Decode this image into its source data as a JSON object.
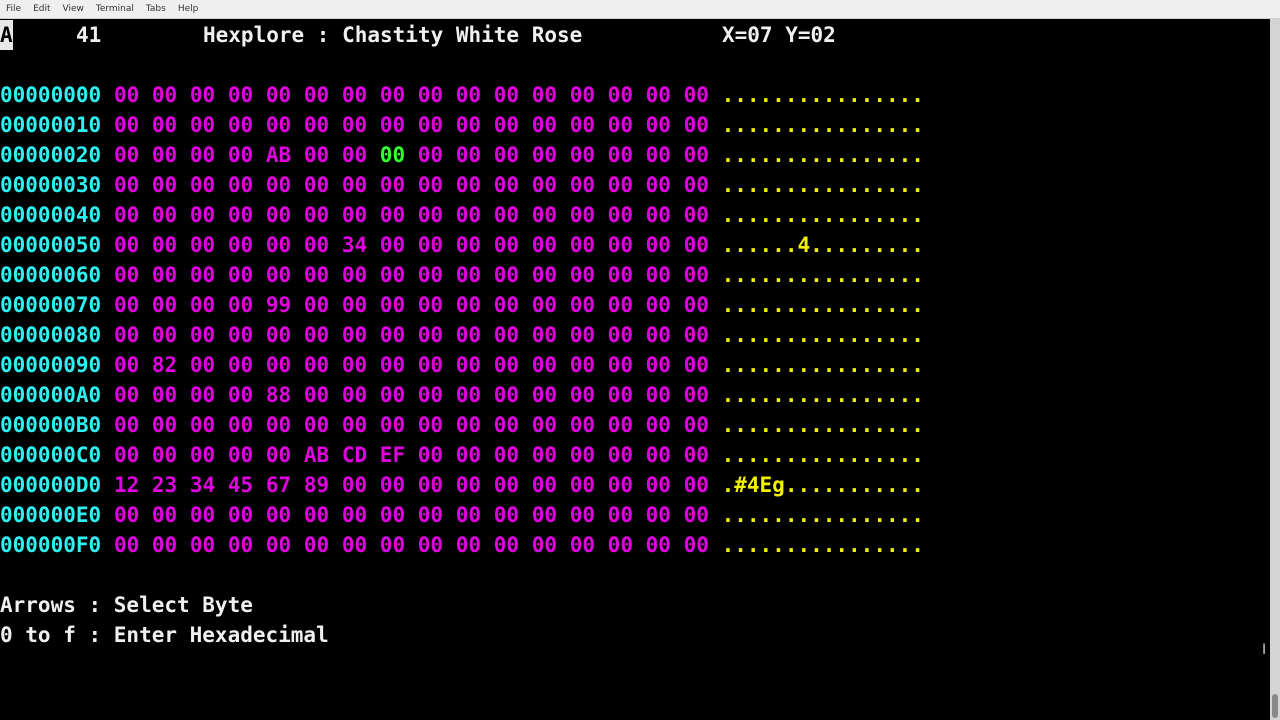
{
  "menu": [
    "File",
    "Edit",
    "View",
    "Terminal",
    "Tabs",
    "Help"
  ],
  "header": {
    "cursor_char": "A",
    "cursor_hex": "41",
    "title": "Hexplore : Chastity White Rose",
    "position": "X=07 Y=02"
  },
  "selected": {
    "x": 7,
    "y": 2
  },
  "rows": [
    {
      "addr": "00000000",
      "bytes": [
        "00",
        "00",
        "00",
        "00",
        "00",
        "00",
        "00",
        "00",
        "00",
        "00",
        "00",
        "00",
        "00",
        "00",
        "00",
        "00"
      ],
      "ascii": "................"
    },
    {
      "addr": "00000010",
      "bytes": [
        "00",
        "00",
        "00",
        "00",
        "00",
        "00",
        "00",
        "00",
        "00",
        "00",
        "00",
        "00",
        "00",
        "00",
        "00",
        "00"
      ],
      "ascii": "................"
    },
    {
      "addr": "00000020",
      "bytes": [
        "00",
        "00",
        "00",
        "00",
        "AB",
        "00",
        "00",
        "00",
        "00",
        "00",
        "00",
        "00",
        "00",
        "00",
        "00",
        "00"
      ],
      "ascii": "................"
    },
    {
      "addr": "00000030",
      "bytes": [
        "00",
        "00",
        "00",
        "00",
        "00",
        "00",
        "00",
        "00",
        "00",
        "00",
        "00",
        "00",
        "00",
        "00",
        "00",
        "00"
      ],
      "ascii": "................"
    },
    {
      "addr": "00000040",
      "bytes": [
        "00",
        "00",
        "00",
        "00",
        "00",
        "00",
        "00",
        "00",
        "00",
        "00",
        "00",
        "00",
        "00",
        "00",
        "00",
        "00"
      ],
      "ascii": "................"
    },
    {
      "addr": "00000050",
      "bytes": [
        "00",
        "00",
        "00",
        "00",
        "00",
        "00",
        "34",
        "00",
        "00",
        "00",
        "00",
        "00",
        "00",
        "00",
        "00",
        "00"
      ],
      "ascii": "......4........."
    },
    {
      "addr": "00000060",
      "bytes": [
        "00",
        "00",
        "00",
        "00",
        "00",
        "00",
        "00",
        "00",
        "00",
        "00",
        "00",
        "00",
        "00",
        "00",
        "00",
        "00"
      ],
      "ascii": "................"
    },
    {
      "addr": "00000070",
      "bytes": [
        "00",
        "00",
        "00",
        "00",
        "99",
        "00",
        "00",
        "00",
        "00",
        "00",
        "00",
        "00",
        "00",
        "00",
        "00",
        "00"
      ],
      "ascii": "................"
    },
    {
      "addr": "00000080",
      "bytes": [
        "00",
        "00",
        "00",
        "00",
        "00",
        "00",
        "00",
        "00",
        "00",
        "00",
        "00",
        "00",
        "00",
        "00",
        "00",
        "00"
      ],
      "ascii": "................"
    },
    {
      "addr": "00000090",
      "bytes": [
        "00",
        "82",
        "00",
        "00",
        "00",
        "00",
        "00",
        "00",
        "00",
        "00",
        "00",
        "00",
        "00",
        "00",
        "00",
        "00"
      ],
      "ascii": "................"
    },
    {
      "addr": "000000A0",
      "bytes": [
        "00",
        "00",
        "00",
        "00",
        "88",
        "00",
        "00",
        "00",
        "00",
        "00",
        "00",
        "00",
        "00",
        "00",
        "00",
        "00"
      ],
      "ascii": "................"
    },
    {
      "addr": "000000B0",
      "bytes": [
        "00",
        "00",
        "00",
        "00",
        "00",
        "00",
        "00",
        "00",
        "00",
        "00",
        "00",
        "00",
        "00",
        "00",
        "00",
        "00"
      ],
      "ascii": "................"
    },
    {
      "addr": "000000C0",
      "bytes": [
        "00",
        "00",
        "00",
        "00",
        "00",
        "AB",
        "CD",
        "EF",
        "00",
        "00",
        "00",
        "00",
        "00",
        "00",
        "00",
        "00"
      ],
      "ascii": "................"
    },
    {
      "addr": "000000D0",
      "bytes": [
        "12",
        "23",
        "34",
        "45",
        "67",
        "89",
        "00",
        "00",
        "00",
        "00",
        "00",
        "00",
        "00",
        "00",
        "00",
        "00"
      ],
      "ascii": ".#4Eg..........."
    },
    {
      "addr": "000000E0",
      "bytes": [
        "00",
        "00",
        "00",
        "00",
        "00",
        "00",
        "00",
        "00",
        "00",
        "00",
        "00",
        "00",
        "00",
        "00",
        "00",
        "00"
      ],
      "ascii": "................"
    },
    {
      "addr": "000000F0",
      "bytes": [
        "00",
        "00",
        "00",
        "00",
        "00",
        "00",
        "00",
        "00",
        "00",
        "00",
        "00",
        "00",
        "00",
        "00",
        "00",
        "00"
      ],
      "ascii": "................"
    }
  ],
  "help": [
    "Arrows : Select Byte",
    "0 to f : Enter Hexadecimal"
  ],
  "colors": {
    "address": "#2ff0f0",
    "byte": "#e000e0",
    "selected": "#33ff33",
    "ascii": "#f0f000"
  }
}
